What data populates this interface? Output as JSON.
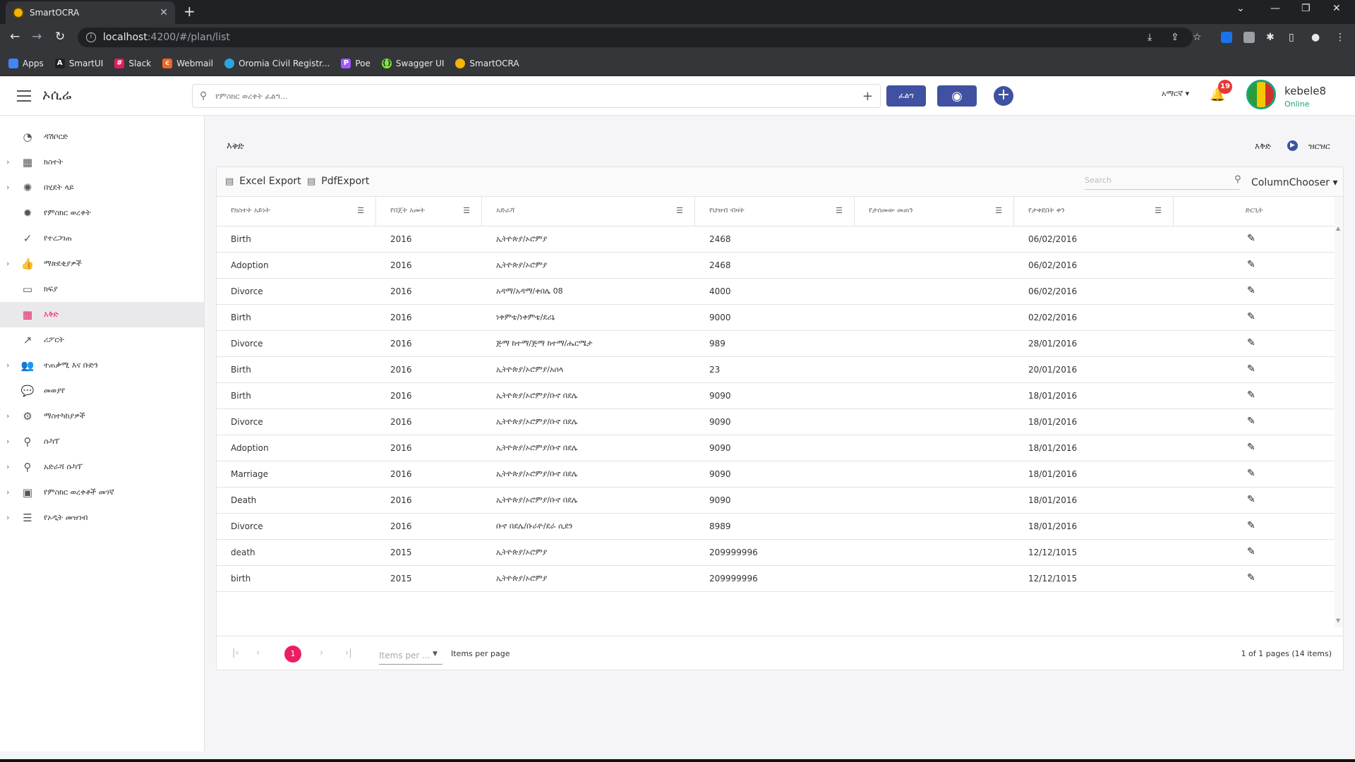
{
  "browser": {
    "tab_title": "SmartOCRA",
    "url_host": "localhost",
    "url_path": ":4200/#/plan/list",
    "bookmarks": [
      {
        "label": "Apps",
        "icon": "apps-grid-icon",
        "color": "#e8eaed"
      },
      {
        "label": "SmartUI",
        "icon": "a-letter-icon",
        "color": "#202124"
      },
      {
        "label": "Slack",
        "icon": "slack-icon",
        "color": "#e01e5a"
      },
      {
        "label": "Webmail",
        "icon": "webmail-icon",
        "color": "#f26522"
      },
      {
        "label": "Oromia Civil Registr...",
        "icon": "cloud-icon",
        "color": "#29a8e0"
      },
      {
        "label": "Poe",
        "icon": "poe-icon",
        "color": "#a259ff"
      },
      {
        "label": "Swagger UI",
        "icon": "swagger-icon",
        "color": "#85ea2d"
      },
      {
        "label": "SmartOCRA",
        "icon": "smartocra-icon",
        "color": "#f4b400"
      }
    ]
  },
  "header": {
    "brand": "ኦሲሬ",
    "search_placeholder": "የምስክር ወረቀት ፈልግ...",
    "search_button": "ፈልግ",
    "language": "አማርኛ",
    "notification_count": "19",
    "username": "kebele8",
    "status": "Online"
  },
  "sidebar": {
    "items": [
      {
        "label": "ዳሽቦርድ",
        "icon": "dashboard-icon",
        "chevron": false,
        "active": false
      },
      {
        "label": "ክስተት",
        "icon": "calendar-icon",
        "chevron": true,
        "active": false
      },
      {
        "label": "በሂደት ላይ",
        "icon": "spinner-icon",
        "chevron": true,
        "active": false
      },
      {
        "label": "የምስክር ወረቀት",
        "icon": "certificate-icon",
        "chevron": false,
        "active": false
      },
      {
        "label": "የተረጋገጠ",
        "icon": "verified-icon",
        "chevron": false,
        "active": false
      },
      {
        "label": "ማጽደቂያዎች",
        "icon": "thumbs-up-icon",
        "chevron": true,
        "active": false
      },
      {
        "label": "ክፍያ",
        "icon": "payment-card-icon",
        "chevron": false,
        "active": false
      },
      {
        "label": "እቅድ",
        "icon": "plan-calendar-icon",
        "chevron": false,
        "active": true
      },
      {
        "label": "ሪፖርት",
        "icon": "report-chart-icon",
        "chevron": false,
        "active": false
      },
      {
        "label": "ተጠቃሚ እና ቡድን",
        "icon": "users-icon",
        "chevron": true,
        "active": false
      },
      {
        "label": "መወያየ",
        "icon": "chat-icon",
        "chevron": false,
        "active": false
      },
      {
        "label": "ማስተካከያዎች",
        "icon": "gear-icon",
        "chevron": true,
        "active": false
      },
      {
        "label": "ሱካፕ",
        "icon": "zoom-icon",
        "chevron": true,
        "active": false
      },
      {
        "label": "አድራሻ ሱካፕ",
        "icon": "address-zoom-icon",
        "chevron": true,
        "active": false
      },
      {
        "label": "የምስክር ወረቀቶች መገኛ",
        "icon": "archive-icon",
        "chevron": true,
        "active": false
      },
      {
        "label": "የኦዲት መዝገብ",
        "icon": "audit-list-icon",
        "chevron": true,
        "active": false
      }
    ]
  },
  "page": {
    "title": "እቅድ",
    "breadcrumb_current": "እቅድ",
    "breadcrumb_next": "ዝርዝር"
  },
  "grid": {
    "excel_export": "Excel Export",
    "pdf_export": "PdfExport",
    "search_placeholder": "Search",
    "column_chooser": "ColumnChooser",
    "columns": [
      "የክስተት አይነት",
      "የበጀት አመት",
      "አድራሻ",
      "የህዝብ ብዛት",
      "የታሰመው መጠን",
      "የታቀደበት ቀን",
      "ድርጊት"
    ],
    "rows": [
      {
        "type": "Birth",
        "year": "2016",
        "address": "ኢትዮጵያ/ኦሮምያ",
        "population": "2468",
        "target": "",
        "date": "06/02/2016"
      },
      {
        "type": "Adoption",
        "year": "2016",
        "address": "ኢትዮጵያ/ኦሮምያ",
        "population": "2468",
        "target": "",
        "date": "06/02/2016"
      },
      {
        "type": "Divorce",
        "year": "2016",
        "address": "አዳማ/አዳማ/ቀበሌ 08",
        "population": "4000",
        "target": "",
        "date": "06/02/2016"
      },
      {
        "type": "Birth",
        "year": "2016",
        "address": "ነቀምቴ/ነቀምቴ/ደሪኔ",
        "population": "9000",
        "target": "",
        "date": "02/02/2016"
      },
      {
        "type": "Divorce",
        "year": "2016",
        "address": "ጅማ ከተማ/ጅማ ከተማ/ሔርሜታ",
        "population": "989",
        "target": "",
        "date": "28/01/2016"
      },
      {
        "type": "Birth",
        "year": "2016",
        "address": "ኢትዮጵያ/ኦሮምያ/አሰላ",
        "population": "23",
        "target": "",
        "date": "20/01/2016"
      },
      {
        "type": "Birth",
        "year": "2016",
        "address": "ኢትዮጵያ/ኦሮምያ/ቡኖ በደሌ",
        "population": "9090",
        "target": "",
        "date": "18/01/2016"
      },
      {
        "type": "Divorce",
        "year": "2016",
        "address": "ኢትዮጵያ/ኦሮምያ/ቡኖ በደሌ",
        "population": "9090",
        "target": "",
        "date": "18/01/2016"
      },
      {
        "type": "Adoption",
        "year": "2016",
        "address": "ኢትዮጵያ/ኦሮምያ/ቡኖ በደሌ",
        "population": "9090",
        "target": "",
        "date": "18/01/2016"
      },
      {
        "type": "Marriage",
        "year": "2016",
        "address": "ኢትዮጵያ/ኦሮምያ/ቡኖ በደሌ",
        "population": "9090",
        "target": "",
        "date": "18/01/2016"
      },
      {
        "type": "Death",
        "year": "2016",
        "address": "ኢትዮጵያ/ኦሮምያ/ቡኖ በደሌ",
        "population": "9090",
        "target": "",
        "date": "18/01/2016"
      },
      {
        "type": "Divorce",
        "year": "2016",
        "address": "ቡኖ በደሌ/ቡራዮ/ደራ ሲደን",
        "population": "8989",
        "target": "",
        "date": "18/01/2016"
      },
      {
        "type": "death",
        "year": "2015",
        "address": "ኢትዮጵያ/ኦሮምያ",
        "population": "209999996",
        "target": "",
        "date": "12/12/1015"
      },
      {
        "type": "birth",
        "year": "2015",
        "address": "ኢትዮጵያ/ኦሮምያ",
        "population": "209999996",
        "target": "",
        "date": "12/12/1015"
      }
    ],
    "pager": {
      "current_page": "1",
      "items_per_page_placeholder": "Items per ...",
      "items_per_page_label": "Items per page",
      "info": "1 of 1 pages (14 items)"
    }
  }
}
